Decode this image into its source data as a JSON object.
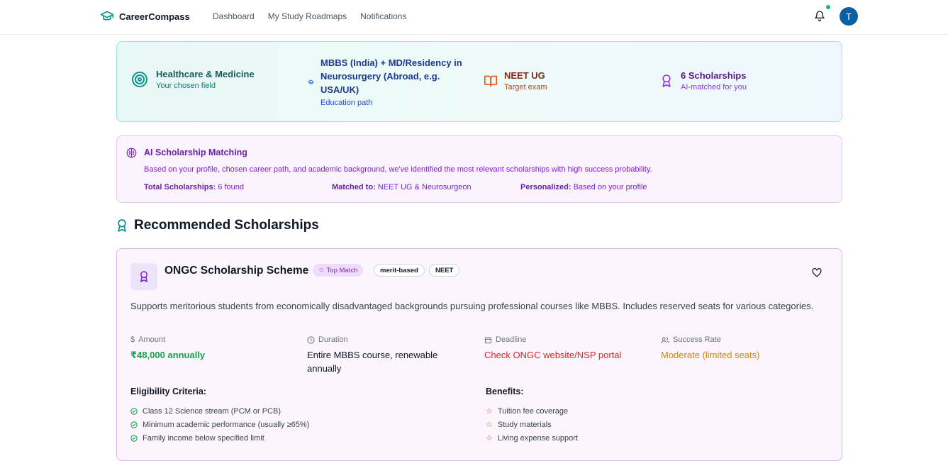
{
  "header": {
    "brand": "CareerCompass",
    "nav": [
      "Dashboard",
      "My Study Roadmaps",
      "Notifications"
    ],
    "avatar_initial": "T"
  },
  "summary": {
    "field": {
      "title": "Healthcare & Medicine",
      "sub": "Your chosen field"
    },
    "education": {
      "title": "MBBS (India) + MD/Residency in Neurosurgery (Abroad, e.g. USA/UK)",
      "sub": "Education path"
    },
    "exam": {
      "title": "NEET UG",
      "sub": "Target exam"
    },
    "scholarships": {
      "title": "6 Scholarships",
      "sub": "AI-matched for you"
    }
  },
  "ai_matching": {
    "title": "AI Scholarship Matching",
    "description": "Based on your profile, chosen career path, and academic background, we've identified the most relevant scholarships with high success probability.",
    "total_label": "Total Scholarships:",
    "total_value": "6 found",
    "matched_label": "Matched to:",
    "matched_value": "NEET UG & Neurosurgeon",
    "personalized_label": "Personalized:",
    "personalized_value": "Based on your profile"
  },
  "section_title": "Recommended Scholarships",
  "scholarship": {
    "name": "ONGC Scholarship Scheme",
    "top_match": "Top Match",
    "tags": [
      "merit-based",
      "NEET"
    ],
    "description": "Supports meritorious students from economically disadvantaged backgrounds pursuing professional courses like MBBS. Includes reserved seats for various categories.",
    "amount_label": "Amount",
    "amount": "₹48,000 annually",
    "duration_label": "Duration",
    "duration": "Entire MBBS course, renewable annually",
    "deadline_label": "Deadline",
    "deadline": "Check ONGC website/NSP portal",
    "success_label": "Success Rate",
    "success": "Moderate (limited seats)",
    "eligibility_title": "Eligibility Criteria:",
    "eligibility": [
      "Class 12 Science stream (PCM or PCB)",
      "Minimum academic performance (usually ≥65%)",
      "Family income below specified limit"
    ],
    "benefits_title": "Benefits:",
    "benefits": [
      "Tuition fee coverage",
      "Study materials",
      "Living expense support"
    ]
  },
  "colors": {
    "brand": "#0d9488",
    "purple": "#7e22ce",
    "green_value": "#16a34a",
    "red_value": "#dc2626",
    "amber_value": "#ca8a04",
    "avatar": "#0b5fa5"
  }
}
